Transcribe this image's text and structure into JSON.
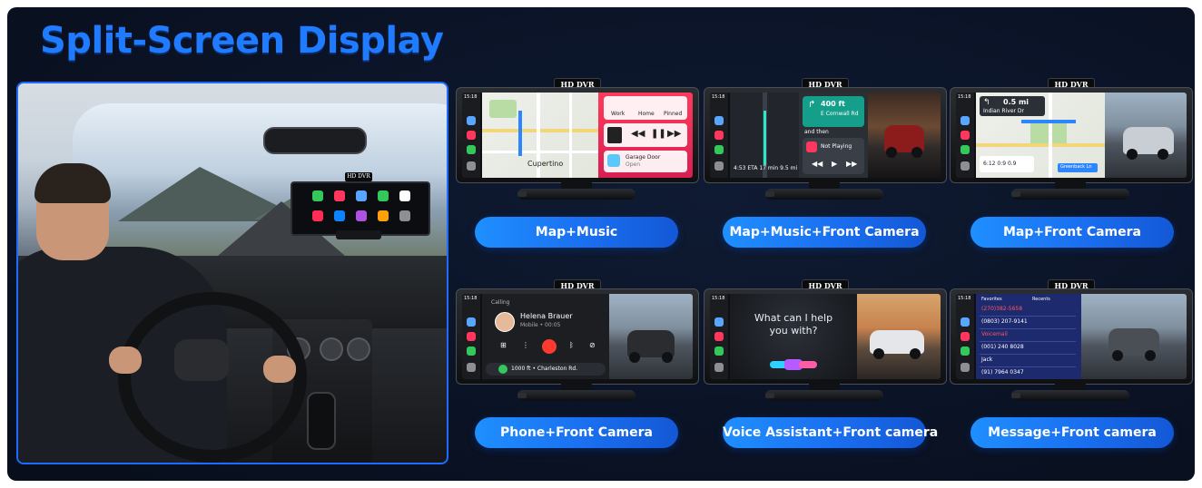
{
  "title": "Split-Screen Display",
  "hero": {
    "dvr_tag": "HD DVR"
  },
  "devices": [
    {
      "dvr_tag": "HD DVR",
      "label": "Map+Music",
      "texts": {
        "dock_time": "15:18",
        "map_city": "Cupertino",
        "card1_a": "Work",
        "card1_b": "Home",
        "card1_c": "Pinned",
        "card3_title": "Garage Door",
        "card3_sub": "Open"
      }
    },
    {
      "dvr_tag": "HD DVR",
      "label": "Map+Music+Front Camera",
      "texts": {
        "dock_time": "15:18",
        "nav_dist": "400 ft",
        "nav_street": "E Cornwall Rd",
        "nav_then": "and then",
        "eta": "4:53  ETA   17 min   9.5 mi",
        "now_playing": "Not Playing"
      }
    },
    {
      "dvr_tag": "HD DVR",
      "label": "Map+Front Camera",
      "texts": {
        "dock_time": "15:18",
        "nav_dist": "0.5 mi",
        "nav_street": "Indian River Dr",
        "stats": "6:12   0:9   0.9",
        "bottom_sign": "Greenback Ln"
      }
    },
    {
      "dvr_tag": "HD DVR",
      "label": "Phone+Front Camera",
      "texts": {
        "dock_time": "15:18",
        "calling": "Calling",
        "caller": "Helena Brauer",
        "caller_sub": "Mobile • 00:05",
        "direction": "1000 ft • Charleston Rd."
      }
    },
    {
      "dvr_tag": "HD DVR",
      "label": "Voice Assistant+Front camera",
      "texts": {
        "dock_time": "15:18",
        "prompt_line1": "What can I help",
        "prompt_line2": "you with?"
      }
    },
    {
      "dvr_tag": "HD DVR",
      "label": "Message+Front camera",
      "texts": {
        "dock_time": "15:18",
        "tab1": "Favorites",
        "tab2": "Recents",
        "row1": "(270)382-5658",
        "row2": "(0803) 207-9141",
        "row3": "Voicemail",
        "row4": "(001) 240 8028",
        "row5": "Jack",
        "row6": "(91) 7964 0347"
      }
    }
  ],
  "colors": {
    "title": "#1f7bff",
    "pill": "#1a6ff0",
    "hero_border": "#1e6bff",
    "background": "#0a1224"
  }
}
